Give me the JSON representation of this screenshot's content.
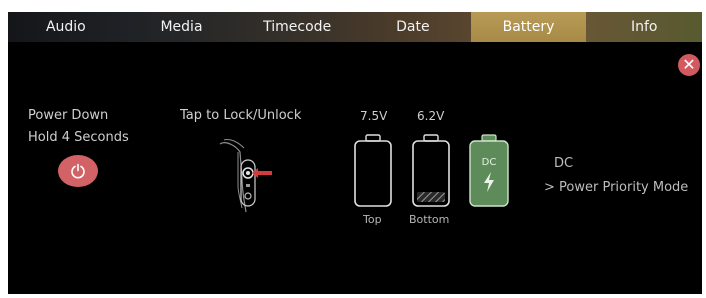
{
  "tabs": [
    {
      "label": "Audio"
    },
    {
      "label": "Media"
    },
    {
      "label": "Timecode"
    },
    {
      "label": "Date"
    },
    {
      "label": "Battery",
      "active": true
    },
    {
      "label": "Info"
    }
  ],
  "power": {
    "line1": "Power Down",
    "line2": "Hold 4 Seconds"
  },
  "lock": {
    "label": "Tap to Lock/Unlock"
  },
  "batteries": {
    "top": {
      "voltage": "7.5V",
      "label": "Top"
    },
    "bottom": {
      "voltage": "6.2V",
      "label": "Bottom"
    },
    "dc": {
      "label": "DC"
    }
  },
  "dc_info": {
    "title": "DC",
    "link": "> Power Priority Mode"
  },
  "colors": {
    "active_tab": "#b79b55",
    "power_button": "#d36266",
    "close_button": "#d05a5f",
    "dc_battery": "#5e8b5a"
  },
  "icons": {
    "close": "close-icon",
    "power": "power-icon",
    "lock_switch": "lock-switch-icon",
    "battery": "battery-icon",
    "bolt": "bolt-icon"
  }
}
